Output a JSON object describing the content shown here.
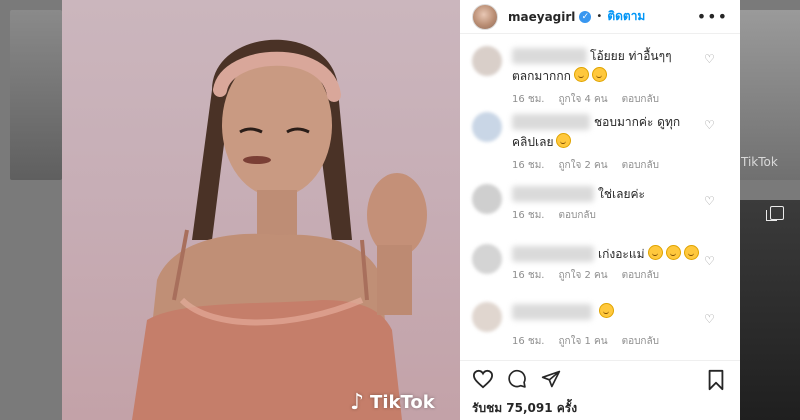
{
  "background": {
    "watermark": "TikTok"
  },
  "media": {
    "watermark": "TikTok"
  },
  "post": {
    "username": "maeyagirl",
    "separator": "•",
    "follow_label": "ติดตาม",
    "more_label": "•••"
  },
  "comments": [
    {
      "text": "โอ้ยยย ท่าอื้นๆๆ",
      "text2": "ตลกมากกก",
      "emojis": 2,
      "time": "16 ชม.",
      "likes": "ถูกใจ 4 คน",
      "reply": "ตอบกลับ"
    },
    {
      "text": "ชอบมากค่ะ ดูทุก",
      "text2": "คลิปเลย",
      "emojis": 1,
      "time": "16 ชม.",
      "likes": "ถูกใจ 2 คน",
      "reply": "ตอบกลับ"
    },
    {
      "text": "ใช่เลยค่ะ",
      "text2": "",
      "emojis": 0,
      "time": "16 ชม.",
      "likes": "",
      "reply": "ตอบกลับ"
    },
    {
      "text": "เก่งอะแม่",
      "text2": "",
      "emojis": 3,
      "time": "16 ชม.",
      "likes": "ถูกใจ 2 คน",
      "reply": "ตอบกลับ"
    },
    {
      "text": "",
      "text2": "",
      "emojis": 1,
      "time": "16 ชม.",
      "likes": "ถูกใจ 1 คน",
      "reply": "ตอบกลับ"
    }
  ],
  "engagement": {
    "likes_text": "รับชม 75,091 ครั้ง"
  },
  "colors": {
    "accent": "#0095f6",
    "verified": "#3897f0",
    "meta": "#8e8e8e"
  }
}
